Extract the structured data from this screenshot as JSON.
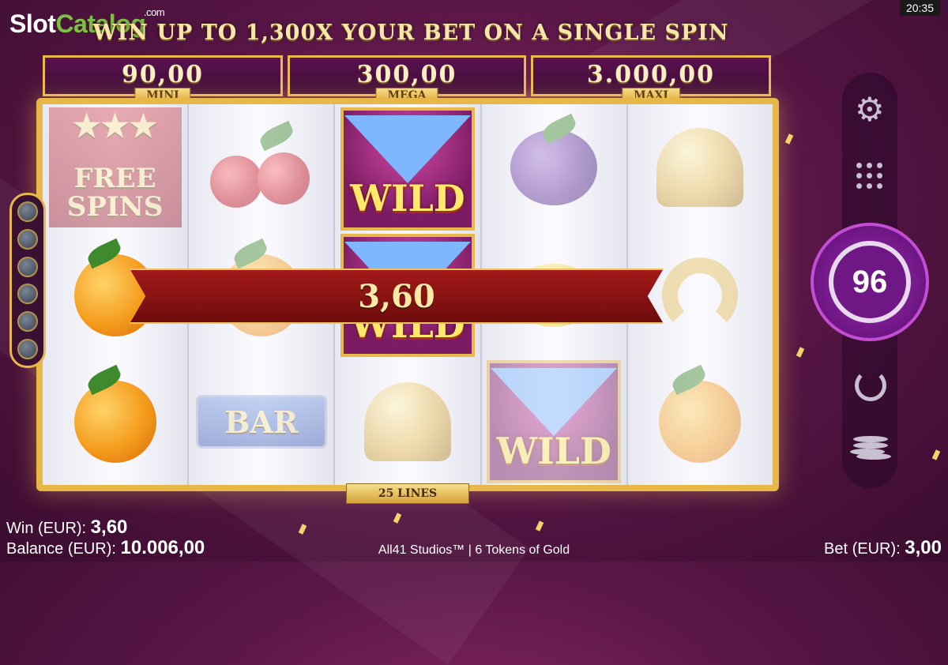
{
  "clock": "20:35",
  "logo": {
    "slot": "Slot",
    "catalog": "Catalog",
    "com": ".com"
  },
  "headline": "WIN UP TO 1,300X YOUR BET ON A SINGLE SPIN",
  "jackpots": [
    {
      "value": "90,00",
      "label": "MINI"
    },
    {
      "value": "300,00",
      "label": "MEGA"
    },
    {
      "value": "3.000,00",
      "label": "MAXI"
    }
  ],
  "symbols": {
    "freespins_line1": "FREE",
    "freespins_line2": "SPINS",
    "bar": "BAR",
    "wild": "WILD"
  },
  "win_banner": "3,60",
  "lines_label": "25 LINES",
  "spin_counter": "96",
  "footer": {
    "win_label": "Win (EUR):",
    "win_value": "3,60",
    "balance_label": "Balance (EUR):",
    "balance_value": "10.006,00",
    "provider": "All41 Studios™ | 6 Tokens of Gold",
    "bet_label": "Bet (EUR):",
    "bet_value": "3,00"
  }
}
